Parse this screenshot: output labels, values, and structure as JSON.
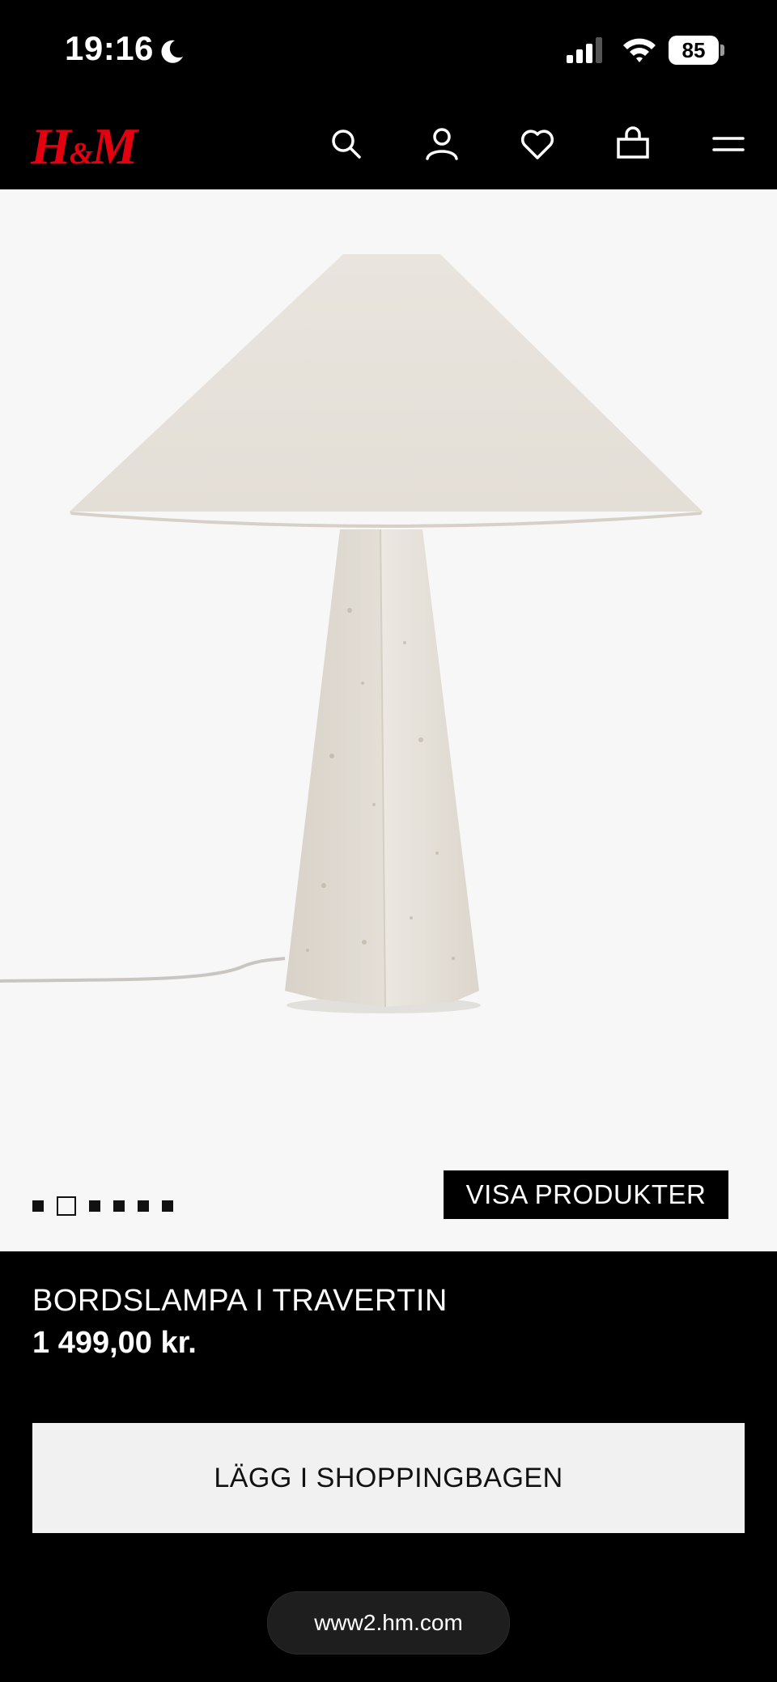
{
  "status_bar": {
    "time": "19:16",
    "battery": "85",
    "moon_icon": "moon-icon",
    "signal_icon": "cellular-signal-icon",
    "wifi_icon": "wifi-icon"
  },
  "header": {
    "logo_main": "H",
    "logo_amp": "&",
    "logo_end": "M",
    "brand_color": "#e50010",
    "icons": [
      "search-icon",
      "account-icon",
      "heart-icon",
      "shopping-bag-icon",
      "menu-icon"
    ]
  },
  "gallery": {
    "image_count": 6,
    "active_index": 1,
    "show_products_label": "VISA PRODUKTER",
    "background": "#f7f7f7"
  },
  "product": {
    "title": "BORDSLAMPA I TRAVERTIN",
    "price": "1 499,00 kr.",
    "add_to_bag_label": "LÄGG I SHOPPINGBAGEN"
  },
  "browser": {
    "url": "www2.hm.com"
  }
}
